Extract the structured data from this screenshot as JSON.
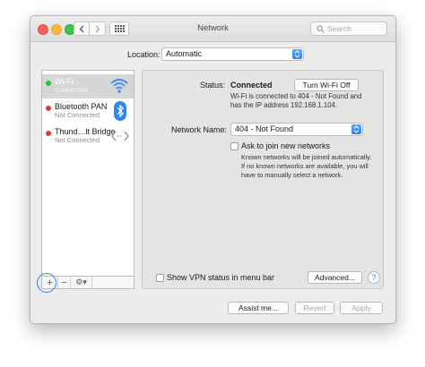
{
  "window": {
    "title": "Network",
    "search_placeholder": "Search"
  },
  "location": {
    "label": "Location:",
    "value": "Automatic"
  },
  "services": [
    {
      "name": "Wi-Fi",
      "status": "Connected",
      "dot_color": "#2cc23f",
      "icon": "wifi-icon"
    },
    {
      "name": "Bluetooth PAN",
      "status": "Not Connected",
      "dot_color": "#e23b36",
      "icon": "bluetooth-icon"
    },
    {
      "name": "Thund…lt Bridge",
      "status": "Not Connected",
      "dot_color": "#e23b36",
      "icon": "thunderbolt-bridge-icon"
    }
  ],
  "sidebar_controls": {
    "add": "+",
    "remove": "−",
    "gear": "⚙▾"
  },
  "detail": {
    "status_label": "Status:",
    "status_value": "Connected",
    "turn_off_button": "Turn Wi-Fi Off",
    "status_description": "Wi-Fi is connected to 404 - Not Found and has the IP address 192.168.1.104.",
    "network_name_label": "Network Name:",
    "network_name_value": "404 - Not Found",
    "ask_label": "Ask to join new networks",
    "ask_description": "Known networks will be joined automatically. If no known networks are available, you will have to manually select a network.",
    "vpn_label": "Show VPN status in menu bar",
    "advanced_button": "Advanced...",
    "help_button": "?"
  },
  "footer": {
    "assist": "Assist me...",
    "revert": "Revert",
    "apply": "Apply"
  },
  "colors": {
    "accent": "#3b7ee9",
    "connected": "#2cc23f",
    "not_connected": "#e23b36"
  }
}
